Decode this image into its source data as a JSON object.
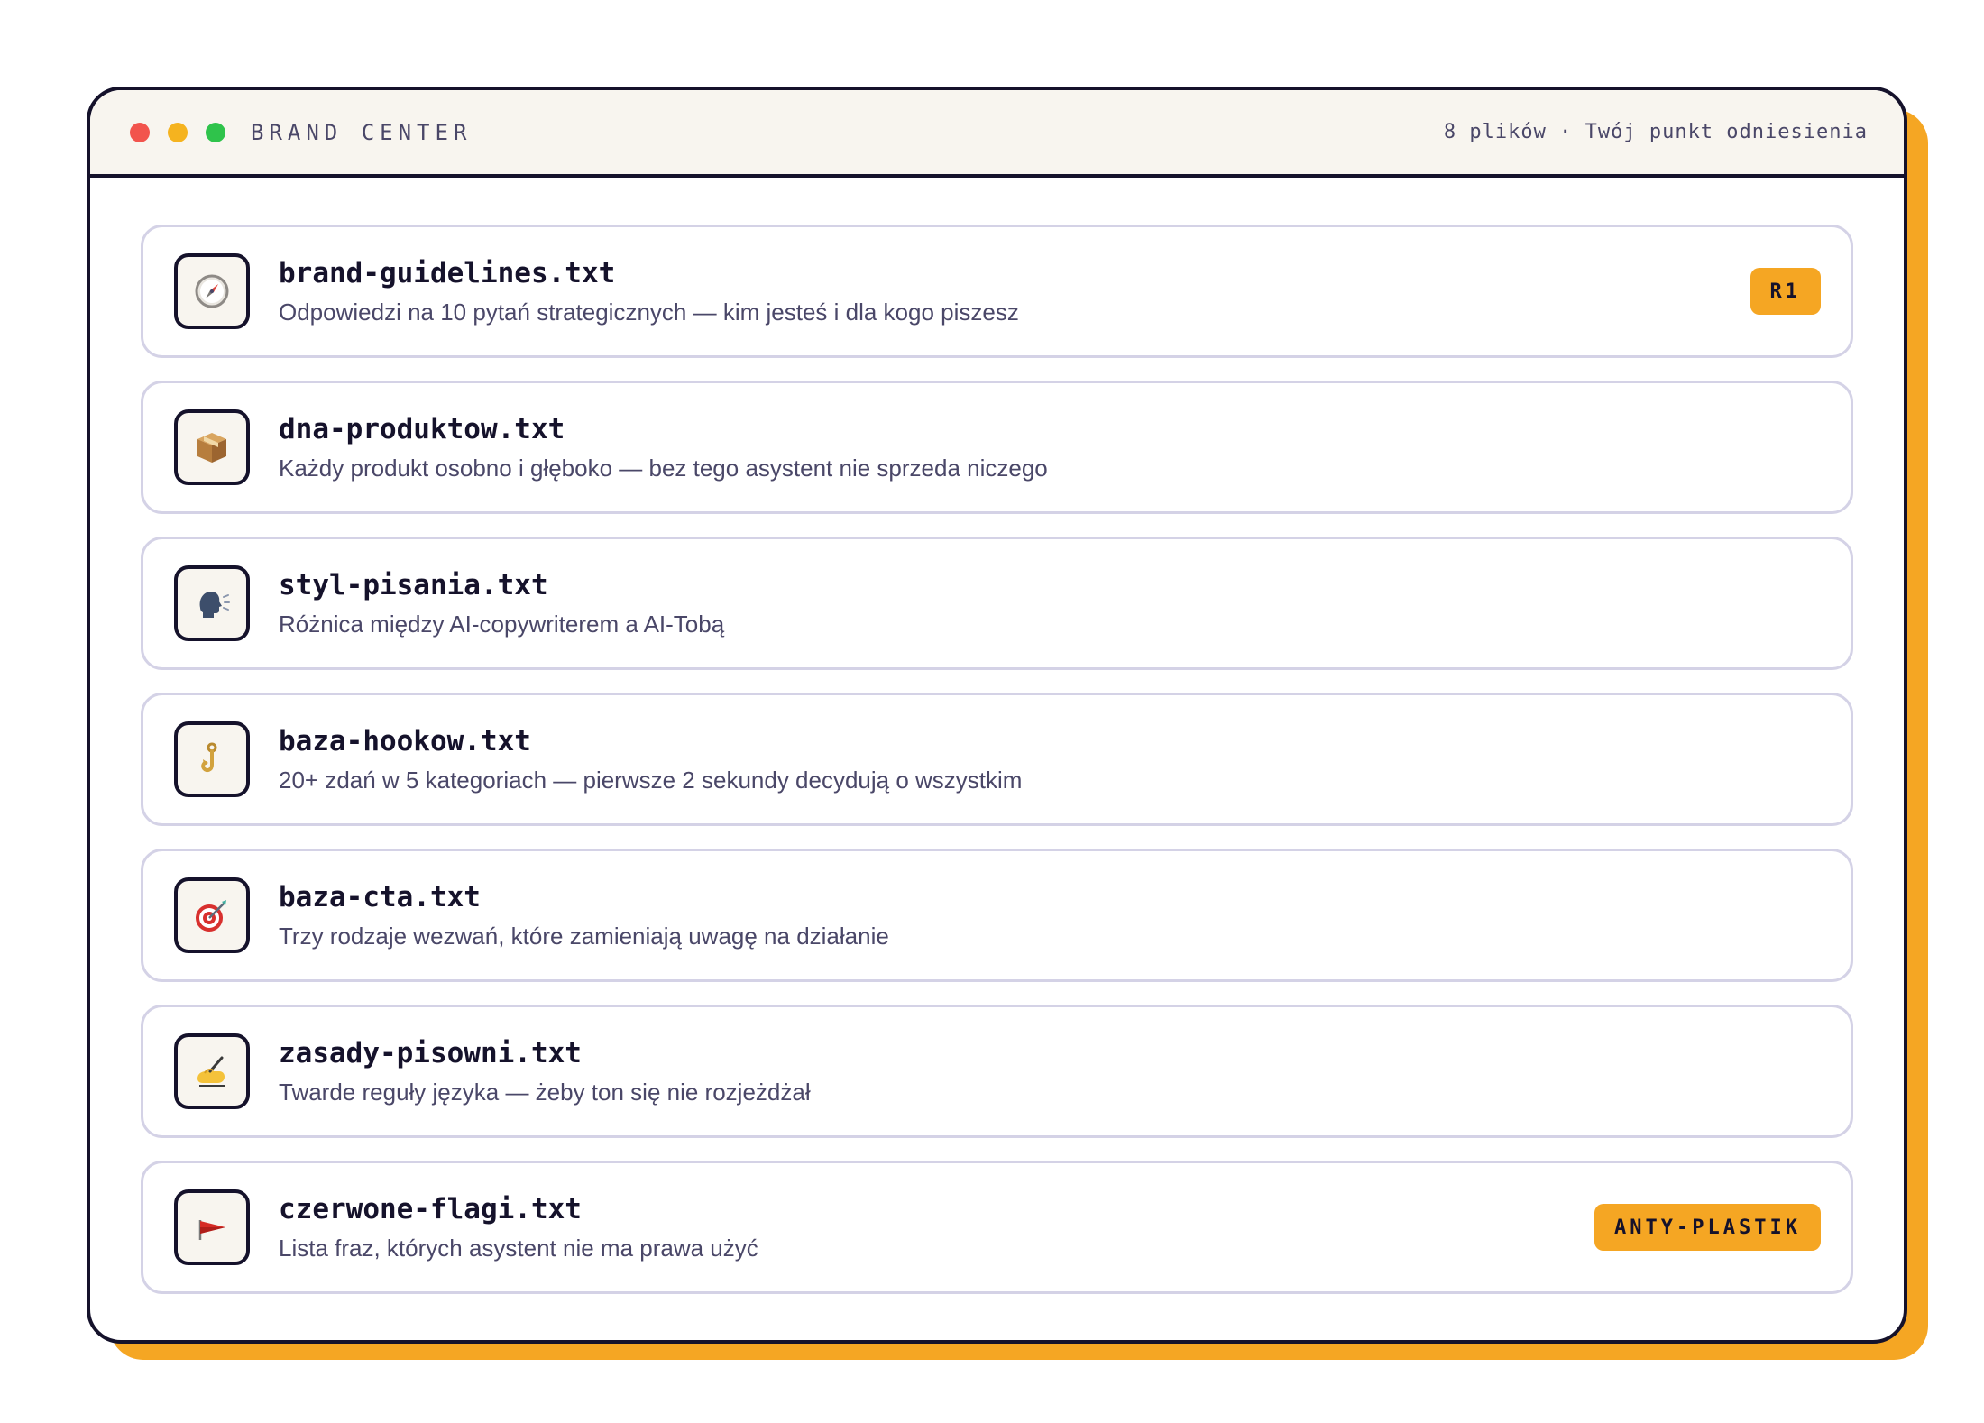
{
  "window": {
    "title": "BRAND CENTER",
    "meta": "8 plików · Twój punkt odniesienia"
  },
  "files": [
    {
      "icon": "compass-icon",
      "name": "brand-guidelines.txt",
      "desc": "Odpowiedzi na 10 pytań strategicznych — kim jesteś i dla kogo piszesz",
      "badge": "R1"
    },
    {
      "icon": "package-icon",
      "name": "dna-produktow.txt",
      "desc": "Każdy produkt osobno i głęboko — bez tego asystent nie sprzeda niczego"
    },
    {
      "icon": "speaking-head-icon",
      "name": "styl-pisania.txt",
      "desc": "Różnica między AI-copywriterem a AI-Tobą"
    },
    {
      "icon": "hook-icon",
      "name": "baza-hookow.txt",
      "desc": "20+ zdań w 5 kategoriach — pierwsze 2 sekundy decydują o wszystkim"
    },
    {
      "icon": "target-icon",
      "name": "baza-cta.txt",
      "desc": "Trzy rodzaje wezwań, które zamieniają uwagę na działanie"
    },
    {
      "icon": "writing-hand-icon",
      "name": "zasady-pisowni.txt",
      "desc": "Twarde reguły języka — żeby ton się nie rozjeżdżał"
    },
    {
      "icon": "red-flag-icon",
      "name": "czerwone-flagi.txt",
      "desc": "Lista fraz, których asystent nie ma prawa użyć",
      "badge": "ANTY-PLASTIK"
    }
  ],
  "colors": {
    "accent": "#F5A623",
    "ink": "#15122B",
    "muted": "#4A4768",
    "border": "#D4D2E6",
    "titlebar": "#F8F5EF"
  }
}
